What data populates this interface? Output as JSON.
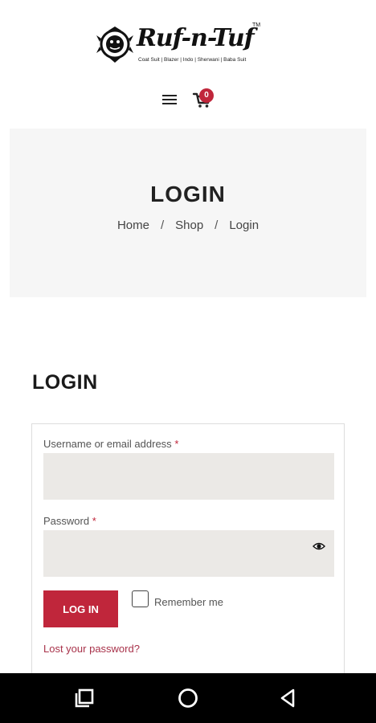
{
  "header": {
    "logo_text": "Ruf-n-Tuf",
    "logo_tm": "TM",
    "logo_tagline": "Coat Suit | Blazer | Indo | Sherwani | Baba Suit",
    "cart_count": "0",
    "menu_icon": "hamburger-menu-icon",
    "cart_icon": "shopping-cart-icon"
  },
  "banner": {
    "title": "LOGIN",
    "breadcrumb": [
      "Home",
      "Shop",
      "Login"
    ],
    "breadcrumb_separator": "/"
  },
  "login_form": {
    "section_title": "LOGIN",
    "username_label": "Username or email address",
    "username_value": "",
    "password_label": "Password",
    "password_value": "",
    "required_marker": "*",
    "login_button": "LOG IN",
    "remember_label": "Remember me",
    "remember_checked": false,
    "lost_password": "Lost your password?"
  },
  "system_nav": {
    "recents_icon": "recents-square-icon",
    "home_icon": "home-circle-icon",
    "back_icon": "back-triangle-icon"
  },
  "colors": {
    "accent": "#c0263b",
    "input_bg": "#ebe9e6",
    "banner_bg": "#f6f6f6",
    "link": "#a8324a"
  }
}
